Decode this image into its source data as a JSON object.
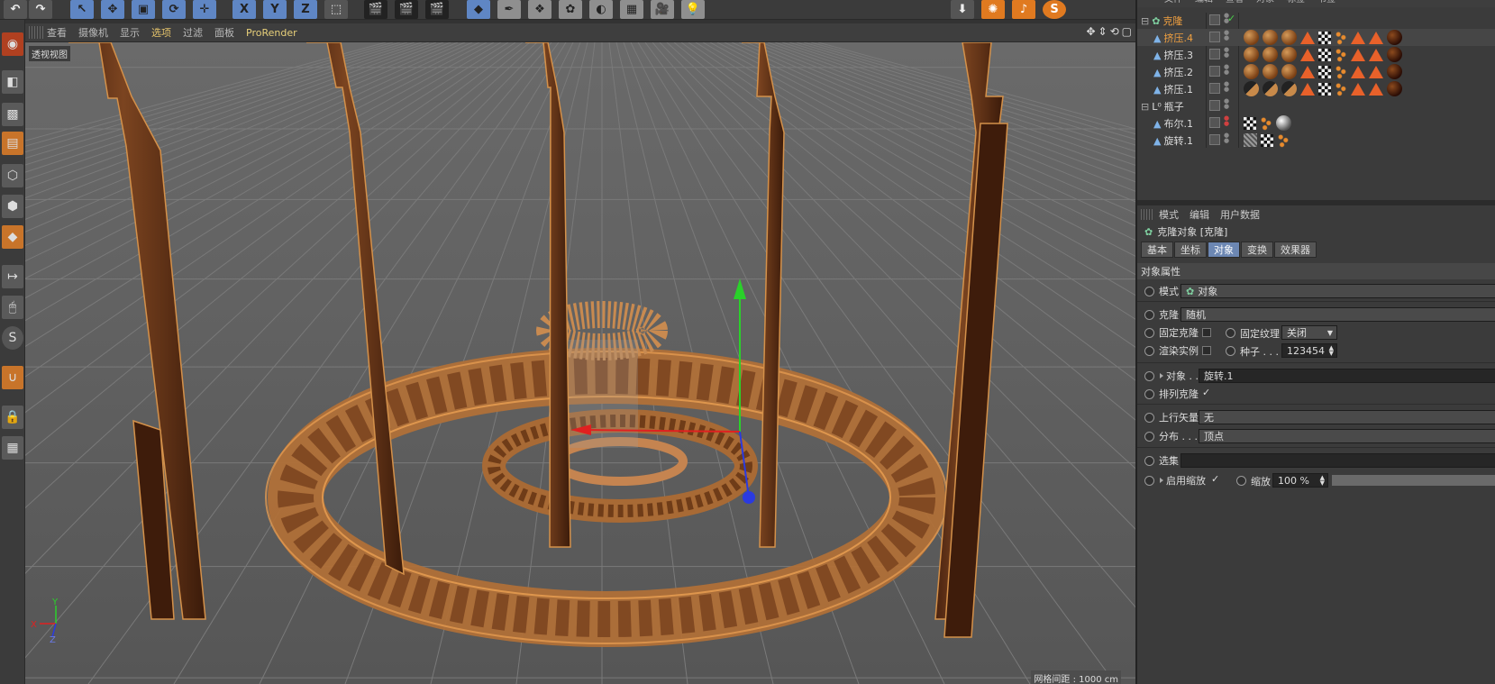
{
  "toolbar": {
    "axis_x": "X",
    "axis_y": "Y",
    "axis_z": "Z"
  },
  "viewport": {
    "menu": [
      "查看",
      "摄像机",
      "显示",
      "选项",
      "过滤",
      "面板",
      "ProRender"
    ],
    "active_menu": "选项",
    "view_label": "透视视图",
    "grid_info": "网格间距 : 1000 cm",
    "axis_labels": {
      "x": "X",
      "y": "Y",
      "z": "Z"
    }
  },
  "object_manager": {
    "menu": [
      "文件",
      "编辑",
      "查看",
      "对象",
      "标签",
      "书签"
    ],
    "objects": [
      {
        "name": "克隆",
        "level": 0,
        "expand": "⊟",
        "highlight": true
      },
      {
        "name": "挤压.4",
        "level": 1,
        "highlight": true
      },
      {
        "name": "挤压.3",
        "level": 1
      },
      {
        "name": "挤压.2",
        "level": 1
      },
      {
        "name": "挤压.1",
        "level": 1
      },
      {
        "name": "瓶子",
        "level": 0,
        "expand": "⊟"
      },
      {
        "name": "布尔.1",
        "level": 1
      },
      {
        "name": "旋转.1",
        "level": 1
      }
    ]
  },
  "attributes": {
    "menu": [
      "模式",
      "编辑",
      "用户数据"
    ],
    "title": "克隆对象 [克隆]",
    "tabs": [
      "基本",
      "坐标",
      "对象",
      "变换",
      "效果器"
    ],
    "active_tab": "对象",
    "section": "对象属性",
    "mode_label": "模式",
    "mode_value": "对象",
    "clone_label": "克隆",
    "clone_value": "随机",
    "fix_clone_label": "固定克隆",
    "fix_texture_label": "固定纹理",
    "fix_texture_value": "关闭",
    "render_instance_label": "渲染实例",
    "seed_label": "种子 . . .",
    "seed_value": "123454",
    "object_label": "对象 . .",
    "object_value": "旋转.1",
    "arrange_label": "排列克隆",
    "arrange_check": "✓",
    "up_vector_label": "上行矢量",
    "up_vector_value": "无",
    "distribution_label": "分布 . . .",
    "distribution_value": "顶点",
    "selection_label": "选集",
    "enable_scale_label": "启用缩放",
    "enable_scale_check": "✓",
    "scale_label": "缩放",
    "scale_value": "100 %"
  }
}
